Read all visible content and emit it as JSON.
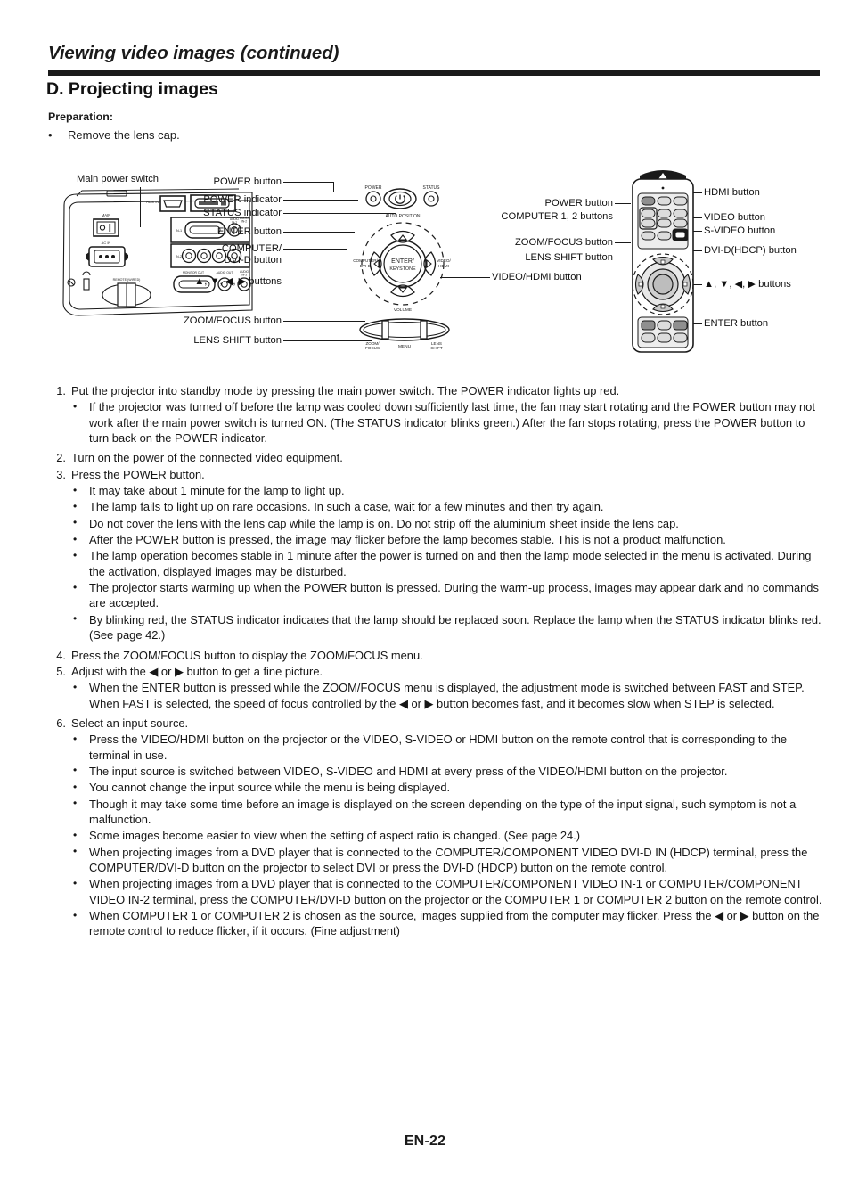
{
  "header": {
    "title": "Viewing video images (continued)"
  },
  "section": {
    "title": "D. Projecting images",
    "preparation_label": "Preparation:",
    "preparation_bullet": "Remove the lens cap.",
    "bullet_char": "•"
  },
  "figure": {
    "projector_labels": {
      "main_power_switch": "Main power switch"
    },
    "control_panel_labels": [
      {
        "text": "POWER button"
      },
      {
        "text": "POWER indicator"
      },
      {
        "text": "STATUS indicator"
      },
      {
        "text": "ENTER button"
      },
      {
        "text": "COMPUTER/"
      },
      {
        "text": "DVI-D button"
      },
      {
        "text": "▲, ▼, ◀, ▶ buttons"
      },
      {
        "text": "ZOOM/FOCUS button"
      },
      {
        "text": "LENS SHIFT button"
      },
      {
        "text": "VIDEO/HDMI button"
      }
    ],
    "remote_left_labels": [
      {
        "text": "POWER button"
      },
      {
        "text": "COMPUTER 1, 2 buttons"
      },
      {
        "text": "ZOOM/FOCUS button"
      },
      {
        "text": "LENS SHIFT button"
      }
    ],
    "remote_right_labels": [
      {
        "text": "HDMI button"
      },
      {
        "text": "VIDEO button"
      },
      {
        "text": "S-VIDEO button"
      },
      {
        "text": "DVI-D(HDCP) button"
      },
      {
        "text": "▲, ▼, ◀, ▶ buttons"
      },
      {
        "text": "ENTER button"
      }
    ],
    "panel_port_labels": [
      "HDMI IN",
      "DVI-D IN (HDCP)",
      "AUDIO IN-1",
      "AUDIO IN-2",
      "IN-1",
      "IN-2",
      "MONITOR OUT",
      "AUDIO OUT",
      "AUDIO IN-3",
      "MAIN",
      "AC IN",
      "REMOTE (WIRED)",
      "SYNC",
      "HD/C",
      "SYNC",
      "VIDEO",
      "S-VIDEO"
    ],
    "control_panel_silk": [
      "POWER",
      "STATUS",
      "AUTO POSITION",
      "ENTER/",
      "KEYSTONE",
      "COMPUTER/",
      "DVI-D",
      "VIDEO/",
      "HDMI",
      "VOLUME",
      "ZOOM/",
      "FOCUS",
      "MENU",
      "LENS",
      "SHIFT"
    ]
  },
  "steps": [
    {
      "num": "1.",
      "text": "Put the projector into standby mode by pressing the main power switch. The POWER indicator lights up red.",
      "subs": [
        "If the projector was turned off before the lamp was cooled down sufficiently last time, the fan may start rotating and the POWER button may not work after the main power switch is turned ON. (The STATUS indicator blinks green.) After the fan stops rotating, press the POWER button to turn back on the POWER indicator."
      ]
    },
    {
      "num": "2.",
      "text": "Turn on the power of the connected video equipment.",
      "subs": []
    },
    {
      "num": "3.",
      "text": "Press the POWER button.",
      "subs": [
        "It may take about 1 minute for the lamp to light up.",
        "The lamp fails to light up on rare occasions. In such a case, wait for a few minutes and then try again.",
        "Do not cover the lens with the lens cap while the lamp is on. Do not strip off the aluminium sheet inside the lens cap.",
        "After the POWER button is pressed, the image may flicker before the lamp becomes stable. This is not a product malfunction.",
        "The lamp operation becomes stable in 1 minute after the power is turned on and then the lamp mode selected in the menu is activated. During the activation, displayed images may be disturbed.",
        "The projector starts warming up when the POWER button is pressed. During the warm-up process, images may appear dark and no commands are accepted.",
        "By blinking red, the STATUS indicator indicates that the lamp should be replaced soon. Replace the lamp when the STATUS indicator blinks red. (See page 42.)"
      ]
    },
    {
      "num": "4.",
      "text": "Press the ZOOM/FOCUS button to display the ZOOM/FOCUS menu.",
      "subs": []
    },
    {
      "num": "5.",
      "text": "Adjust with the ◀ or ▶ button to get a fine picture.",
      "subs": [
        "When the ENTER button is pressed while the ZOOM/FOCUS menu is displayed, the adjustment mode is switched between FAST and STEP. When FAST is selected, the speed of focus controlled by the ◀ or ▶ button becomes fast, and it becomes slow when STEP is selected."
      ]
    },
    {
      "num": "6.",
      "text": "Select an input source.",
      "subs": [
        "Press the VIDEO/HDMI button on the projector or the VIDEO, S-VIDEO or HDMI button on the remote control that is corresponding to the terminal in use.",
        "The input source is switched between VIDEO, S-VIDEO and HDMI at every press of the VIDEO/HDMI button on the projector.",
        "You cannot change the input source while the menu is being displayed.",
        "Though it may take some time before an image is displayed on the screen depending on the type of the input signal, such symptom is not a malfunction.",
        "Some images become easier to view when the setting of aspect ratio is changed. (See page 24.)",
        "When projecting images from a DVD player that is connected to the COMPUTER/COMPONENT VIDEO DVI-D IN (HDCP) terminal, press the COMPUTER/DVI-D button on the projector to select DVI or press the DVI-D (HDCP) button on the remote control.",
        "When projecting images from a DVD player that is connected to the COMPUTER/COMPONENT VIDEO IN-1 or COMPUTER/COMPONENT VIDEO IN-2 terminal, press the COMPUTER/DVI-D button on the projector or the COMPUTER 1 or COMPUTER 2 button on the remote control.",
        "When COMPUTER 1 or COMPUTER 2 is chosen as the source, images supplied from the computer may flicker. Press the ◀ or ▶ button on the remote control to reduce flicker, if it occurs. (Fine adjustment)"
      ]
    }
  ],
  "footer": {
    "page_number": "EN-22"
  },
  "colors": {
    "ink": "#1a1a1a",
    "rule": "#1a1a1a",
    "page_bg": "#ffffff",
    "fill_gray": "#d9d9d9",
    "dark_key": "#595959"
  }
}
